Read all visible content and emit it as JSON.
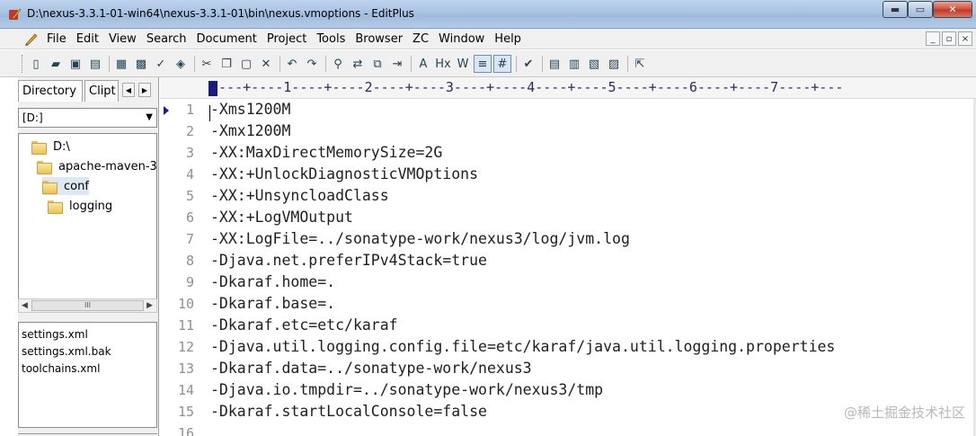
{
  "window": {
    "title": "D:\\nexus-3.3.1-01-win64\\nexus-3.3.1-01\\bin\\nexus.vmoptions - EditPlus",
    "controls": {
      "minimize": "▬",
      "maximize": "▭",
      "close": "✕"
    }
  },
  "menu": {
    "items": [
      "File",
      "Edit",
      "View",
      "Search",
      "Document",
      "Project",
      "Tools",
      "Browser",
      "ZC",
      "Window",
      "Help"
    ],
    "mdi_controls": [
      "_",
      "▫",
      "×"
    ]
  },
  "toolbar": {
    "icons": [
      {
        "name": "new-file-icon",
        "glyph": "▯"
      },
      {
        "name": "open-file-icon",
        "glyph": "▰"
      },
      {
        "name": "save-icon",
        "glyph": "▣"
      },
      {
        "name": "save-all-icon",
        "glyph": "▤"
      },
      {
        "name": "print-preview-icon",
        "glyph": "▦"
      },
      {
        "name": "print-icon",
        "glyph": "▩"
      },
      {
        "name": "spell-check-icon",
        "glyph": "✓"
      },
      {
        "name": "browser-icon",
        "glyph": "◈"
      },
      {
        "name": "cut-icon",
        "glyph": "✂"
      },
      {
        "name": "copy-icon",
        "glyph": "❐"
      },
      {
        "name": "paste-icon",
        "glyph": "▢"
      },
      {
        "name": "delete-icon",
        "glyph": "✕"
      },
      {
        "name": "undo-icon",
        "glyph": "↶"
      },
      {
        "name": "redo-icon",
        "glyph": "↷"
      },
      {
        "name": "find-icon",
        "glyph": "⚲"
      },
      {
        "name": "replace-icon",
        "glyph": "⇄"
      },
      {
        "name": "find-in-files-icon",
        "glyph": "⧉"
      },
      {
        "name": "goto-icon",
        "glyph": "⇥"
      },
      {
        "name": "font-size-icon",
        "glyph": "A"
      },
      {
        "name": "hex-view-icon",
        "glyph": "Hx"
      },
      {
        "name": "word-wrap-icon",
        "glyph": "W"
      },
      {
        "name": "toggle-wrap-icon",
        "glyph": "≡"
      },
      {
        "name": "line-number-icon",
        "glyph": "#"
      },
      {
        "name": "check-icon",
        "glyph": "✔"
      },
      {
        "name": "cliptext-icon",
        "glyph": "▤"
      },
      {
        "name": "directory-icon",
        "glyph": "▥"
      },
      {
        "name": "output-window-icon",
        "glyph": "▧"
      },
      {
        "name": "full-screen-icon",
        "glyph": "▨"
      },
      {
        "name": "help-icon",
        "glyph": "⇱"
      }
    ]
  },
  "sidebar": {
    "tabs": [
      "Directory",
      "Clipt"
    ],
    "drive": "[D:]",
    "tree": [
      {
        "label": "D:\\",
        "indent": 0
      },
      {
        "label": "apache-maven-3",
        "indent": 1
      },
      {
        "label": "conf",
        "indent": 2,
        "selected": true
      },
      {
        "label": "logging",
        "indent": 3
      }
    ],
    "scroll_thumb": "III",
    "files": [
      "settings.xml",
      "settings.xml.bak",
      "toolchains.xml"
    ]
  },
  "ruler": "----+----1----+----2----+----3----+----4----+----5----+----6----+----7----+---",
  "editor": {
    "lines": [
      {
        "num": "1",
        "text": "-Xms1200M"
      },
      {
        "num": "2",
        "text": "-Xmx1200M"
      },
      {
        "num": "3",
        "text": "-XX:MaxDirectMemorySize=2G"
      },
      {
        "num": "4",
        "text": "-XX:+UnlockDiagnosticVMOptions"
      },
      {
        "num": "5",
        "text": "-XX:+UnsyncloadClass"
      },
      {
        "num": "6",
        "text": "-XX:+LogVMOutput"
      },
      {
        "num": "7",
        "text": "-XX:LogFile=../sonatype-work/nexus3/log/jvm.log"
      },
      {
        "num": "8",
        "text": "-Djava.net.preferIPv4Stack=true"
      },
      {
        "num": "9",
        "text": "-Dkaraf.home=."
      },
      {
        "num": "10",
        "text": "-Dkaraf.base=."
      },
      {
        "num": "11",
        "text": "-Dkaraf.etc=etc/karaf"
      },
      {
        "num": "12",
        "text": "-Djava.util.logging.config.file=etc/karaf/java.util.logging.properties"
      },
      {
        "num": "13",
        "text": "-Dkaraf.data=../sonatype-work/nexus3"
      },
      {
        "num": "14",
        "text": "-Djava.io.tmpdir=../sonatype-work/nexus3/tmp"
      },
      {
        "num": "15",
        "text": "-Dkaraf.startLocalConsole=false"
      },
      {
        "num": "16",
        "text": ""
      }
    ]
  },
  "watermark": "@稀土掘金技术社区"
}
